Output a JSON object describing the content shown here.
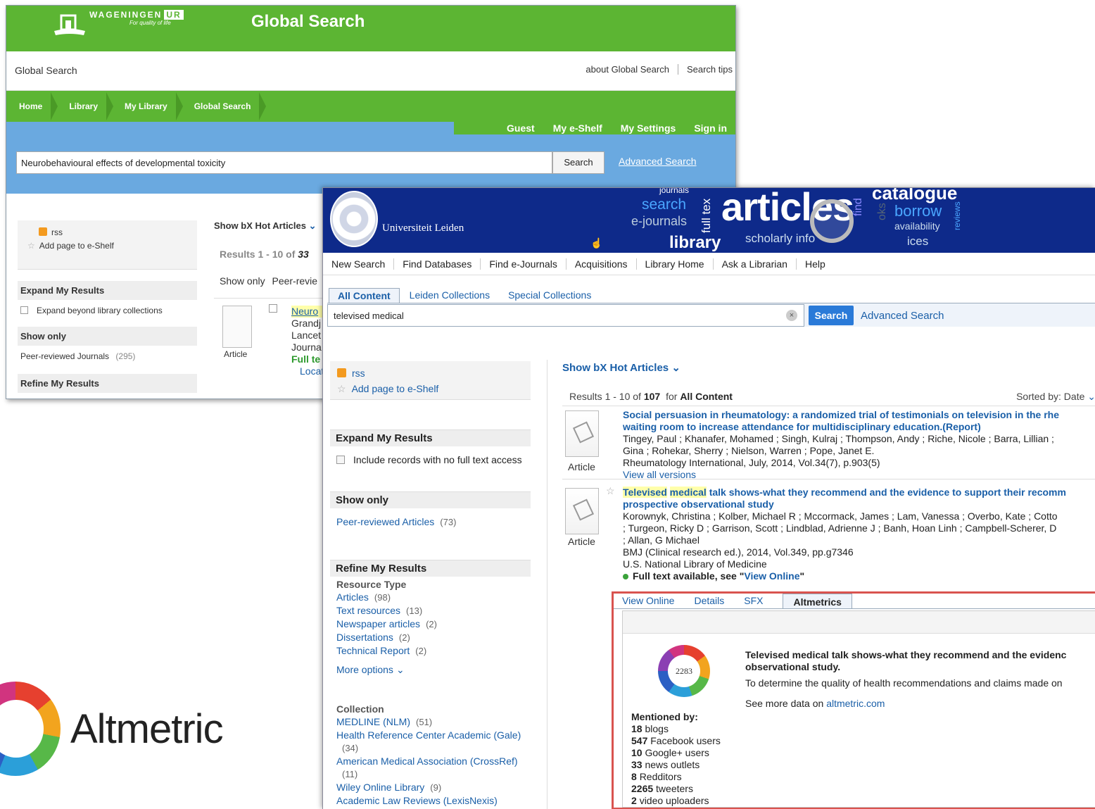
{
  "wur": {
    "brand": "WAGENINGEN",
    "brand_ur": "UR",
    "tagline": "For quality of life",
    "title": "Global Search",
    "subbar_label": "Global Search",
    "links": [
      "about Global Search",
      "Search tips"
    ],
    "breadcrumbs": [
      "Home",
      "Library",
      "My Library",
      "Global Search"
    ],
    "userbar": [
      "Guest",
      "My e-Shelf",
      "My Settings",
      "Sign in"
    ],
    "search_value": "Neurobehavioural effects of developmental toxicity",
    "search_button": "Search",
    "advanced": "Advanced Search",
    "rss": "rss",
    "add_page": "Add page to e-Shelf",
    "expand_heading": "Expand My Results",
    "expand_option": "Expand beyond library collections",
    "show_only_heading": "Show only",
    "peer_reviewed": "Peer-reviewed Journals",
    "peer_count": "(295)",
    "refine_heading": "Refine My Results",
    "hot_articles": "Show bX Hot Articles",
    "results_text": "Results 1 - 10 of",
    "results_num": "33",
    "show_only_label": "Show only",
    "show_only_value": "Peer-revie",
    "rec_title_frag": "Neuro",
    "rec_lines": [
      "Grandj",
      "Lancet",
      "Journa"
    ],
    "rec_fulltext": "Full te",
    "rec_locate": "Locat",
    "article_label": "Article"
  },
  "leiden": {
    "univ_name": "Universiteit Leiden",
    "banner_words": {
      "search": "search",
      "ejournals": "e-journals",
      "library": "library",
      "articles": "articles",
      "scholarly": "scholarly info",
      "catalogue": "catalogue",
      "borrow": "borrow",
      "availability": "availability",
      "journals": "journals",
      "fulltext": "full tex",
      "services": "ices",
      "find": "find",
      "books": "oks",
      "reviews": "reviews"
    },
    "nav": [
      "New Search",
      "Find Databases",
      "Find e-Journals",
      "Acquisitions",
      "Library Home",
      "Ask a Librarian",
      "Help"
    ],
    "tabs": [
      "All Content",
      "Leiden Collections",
      "Special Collections"
    ],
    "search_value": "televised medical",
    "search_button": "Search",
    "advanced": "Advanced Search",
    "clear_icon": "×",
    "rss": "rss",
    "add_page": "Add page to e-Shelf",
    "expand_heading": "Expand My Results",
    "expand_option": "Include records with no full text access",
    "show_only_heading": "Show only",
    "peer_reviewed": "Peer-reviewed Articles",
    "peer_count": "(73)",
    "refine_heading": "Refine My Results",
    "resource_type_label": "Resource Type",
    "resource_types": [
      {
        "label": "Articles",
        "count": "(98)"
      },
      {
        "label": "Text resources",
        "count": "(13)"
      },
      {
        "label": "Newspaper articles",
        "count": "(2)"
      },
      {
        "label": "Dissertations",
        "count": "(2)"
      },
      {
        "label": "Technical Report",
        "count": "(2)"
      }
    ],
    "more_options": "More options",
    "collection_label": "Collection",
    "collections": [
      {
        "label": "MEDLINE (NLM)",
        "count": "(51)"
      },
      {
        "label": "Health Reference Center Academic (Gale)",
        "count": "(34)"
      },
      {
        "label": "American Medical Association (CrossRef)",
        "count": "(11)"
      },
      {
        "label": "Wiley Online Library",
        "count": "(9)"
      },
      {
        "label": "Academic Law Reviews (LexisNexis)",
        "count": ""
      }
    ],
    "hot_articles": "Show bX Hot Articles",
    "results_prefix": "Results 1 - 10 of",
    "results_total": "107",
    "results_for": "for",
    "results_scope": "All Content",
    "sorted_by": "Sorted by:",
    "sort_value": "Date",
    "article_label": "Article",
    "rec1": {
      "title": "Social persuasion in rheumatology: a randomized trial of testimonials on television in the rhe",
      "title2": "waiting room to increase attendance for multidisciplinary education.(Report)",
      "authors": "Tingey, Paul ; Khanafer, Mohamed ; Singh, Kulraj ; Thompson, Andy ; Riche, Nicole ; Barra, Lillian ;",
      "authors2": "Gina ; Rohekar, Sherry ; Nielson, Warren ; Pope, Janet E.",
      "source": "Rheumatology International, July, 2014, Vol.34(7), p.903(5)",
      "versions": "View all versions"
    },
    "rec2": {
      "title_hl1": "Televised",
      "title_hl2": "medical",
      "title_rest": "talk shows-what they recommend and the evidence to support their recomm",
      "title2": "prospective observational study",
      "authors": "Korownyk, Christina ; Kolber, Michael R ; Mccormack, James ; Lam, Vanessa ; Overbo, Kate ; Cotto",
      "authors2": "; Turgeon, Ricky D ; Garrison, Scott ; Lindblad, Adrienne J ; Banh, Hoan Linh ; Campbell-Scherer, D",
      "authors3": "; Allan, G Michael",
      "source": "BMJ (Clinical research ed.), 2014, Vol.349, pp.g7346",
      "publisher": "U.S. National Library of Medicine",
      "fulltext_prefix": "Full text available, see \"",
      "fulltext_link": "View Online",
      "fulltext_suffix": "\""
    },
    "alt_tabs": [
      "View Online",
      "Details",
      "SFX",
      "Altmetrics"
    ],
    "alt_score": "2283",
    "alt_title": "Televised medical talk shows-what they recommend and the evidenc",
    "alt_title2": "observational study.",
    "alt_abstract": "To determine the quality of health recommendations and claims made on",
    "alt_more_prefix": "See more data on",
    "alt_more_link": "altmetric.com",
    "mentioned_by": "Mentioned by:",
    "mentions": [
      {
        "n": "18",
        "label": "blogs"
      },
      {
        "n": "547",
        "label": "Facebook users"
      },
      {
        "n": "10",
        "label": "Google+ users"
      },
      {
        "n": "33",
        "label": "news outlets"
      },
      {
        "n": "8",
        "label": "Redditors"
      },
      {
        "n": "2265",
        "label": "tweeters"
      },
      {
        "n": "2",
        "label": "video uploaders"
      }
    ]
  },
  "altmetric_logo": "Altmetric",
  "colors": {
    "wur_green": "#5cb533",
    "wur_blue": "#6aa9e0",
    "leiden_navy": "#0e2a8a",
    "link_blue": "#1a5fa8",
    "highlight_red": "#d9534f"
  }
}
